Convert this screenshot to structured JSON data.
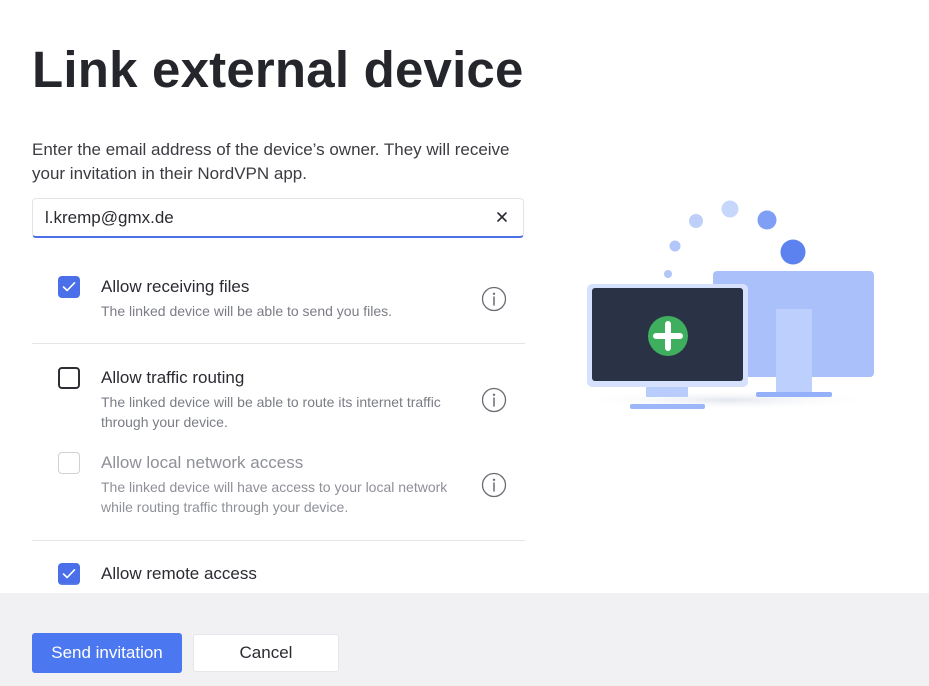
{
  "page": {
    "title": "Link external device"
  },
  "description": "Enter the email address of the device’s owner. They will receive your invitation in their NordVPN app.",
  "email": {
    "value": "l.kremp@gmx.de",
    "placeholder": ""
  },
  "options": [
    {
      "label": "Allow receiving files",
      "description": "The linked device will be able to send you files.",
      "checked": true,
      "disabled": false
    },
    {
      "label": "Allow traffic routing",
      "description": "The linked device will be able to route its internet traffic through your device.",
      "checked": false,
      "disabled": false
    },
    {
      "label": "Allow local network access",
      "description": "The linked device will have access to your local network while routing traffic through your device.",
      "checked": false,
      "disabled": true
    },
    {
      "label": "Allow remote access",
      "description": "",
      "checked": true,
      "disabled": false
    }
  ],
  "footer": {
    "send_label": "Send invitation",
    "cancel_label": "Cancel"
  },
  "colors": {
    "accent": "#4a6fe8",
    "send_button": "#4b78f0",
    "plus_badge": "#3fae5e",
    "monitor_back": "#a9c0fb",
    "footer_bg": "#f1f1f3"
  },
  "icons": {
    "clear": "close-icon",
    "info": "info-icon",
    "check": "checkmark-icon",
    "add": "plus-icon"
  }
}
